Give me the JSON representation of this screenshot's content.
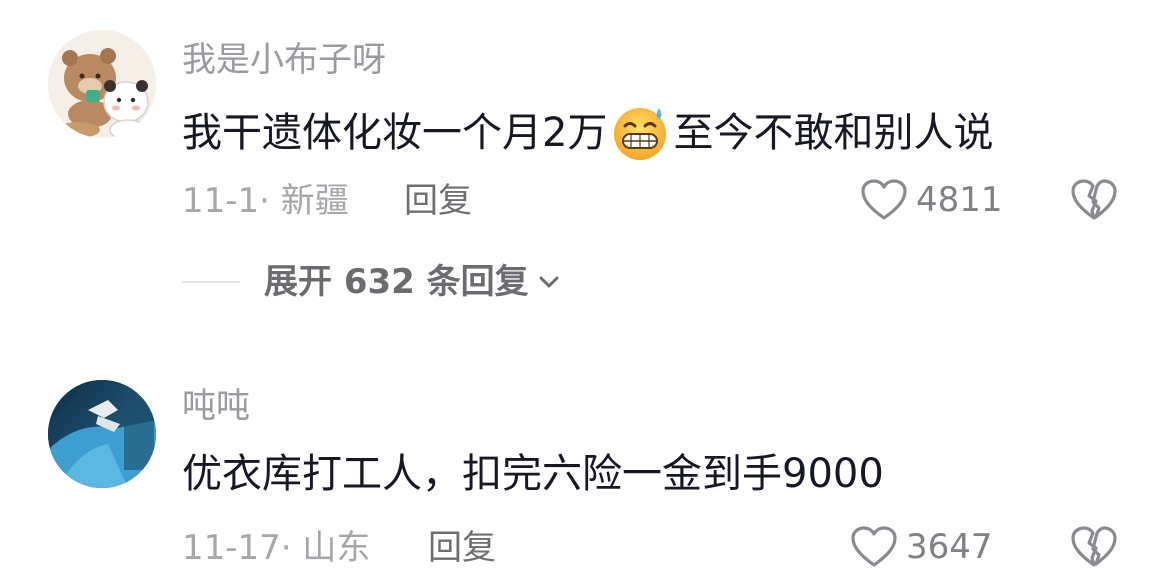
{
  "comments": [
    {
      "username": "我是小布子呀",
      "text_before": "我干遗体化妆一个月2万",
      "emoji": "grinning-sweat-emoji",
      "text_after": "至今不敢和别人说",
      "meta": "11-1· 新疆",
      "reply_label": "回复",
      "likes": "4811",
      "expand_label": "展开 632 条回复"
    },
    {
      "username": "吨吨",
      "text": "优衣库打工人，扣完六险一金到手9000",
      "meta": "11-17· 山东",
      "reply_label": "回复",
      "likes": "3647"
    }
  ],
  "colors": {
    "username": "#9a9aa0",
    "content": "#161823",
    "meta": "#a6a6ab",
    "icon": "#6e6e73"
  }
}
